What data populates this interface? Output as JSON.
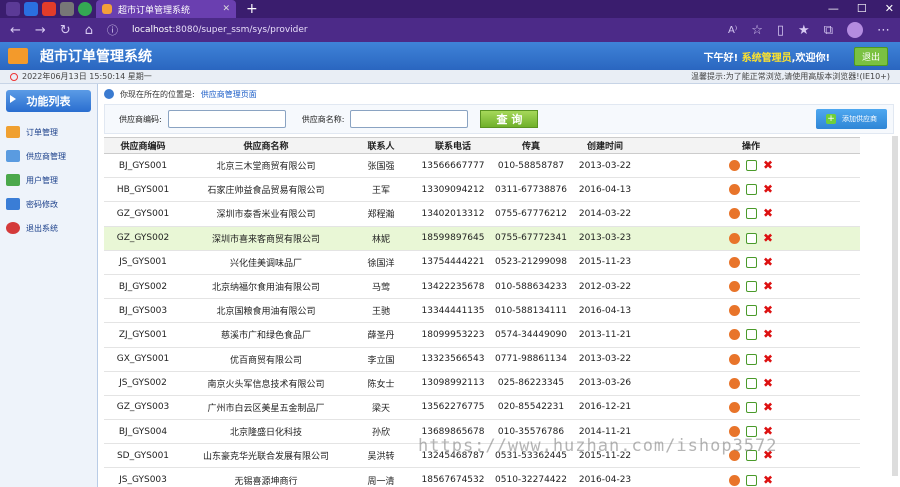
{
  "browser": {
    "tab_title": "超市订单管理系统",
    "url_host": "localhost",
    "url_path": ":8080/super_ssm/sys/provider"
  },
  "header": {
    "app_title": "超市订单管理系统",
    "greet_prefix": "下午好!",
    "user": "系统管理员",
    "greet_suffix": ",欢迎你!",
    "exit_label": "退出"
  },
  "infobar": {
    "datetime": "2022年06月13日 15:50:14 星期一",
    "tip": "温馨提示:为了能正常浏览,请使用高版本浏览器!(IE10+)"
  },
  "sidebar": {
    "heading": "功能列表",
    "items": [
      {
        "label": "订单管理",
        "color": "#f0a030"
      },
      {
        "label": "供应商管理",
        "color": "#5a9be0"
      },
      {
        "label": "用户管理",
        "color": "#4ba84b"
      },
      {
        "label": "密码修改",
        "color": "#3a7dd6"
      },
      {
        "label": "退出系统",
        "color": "#d43a3a"
      }
    ]
  },
  "crumb": {
    "prefix": "你现在所在的位置是:",
    "current": "供应商管理页面"
  },
  "search": {
    "code_label": "供应商编码:",
    "name_label": "供应商名称:",
    "code_value": "",
    "name_value": "",
    "query_label": "查 询",
    "add_label": "添加供应商"
  },
  "table": {
    "headers": [
      "供应商编码",
      "供应商名称",
      "联系人",
      "联系电话",
      "传真",
      "创建时间",
      "操作"
    ],
    "rows": [
      [
        "BJ_GYS001",
        "北京三木堂商贸有限公司",
        "张国强",
        "13566667777",
        "010-58858787",
        "2013-03-22"
      ],
      [
        "HB_GYS001",
        "石家庄帅益食品贸易有限公司",
        "王军",
        "13309094212",
        "0311-67738876",
        "2016-04-13"
      ],
      [
        "GZ_GYS001",
        "深圳市泰香米业有限公司",
        "郑程瀚",
        "13402013312",
        "0755-67776212",
        "2014-03-22"
      ],
      [
        "GZ_GYS002",
        "深圳市喜来客商贸有限公司",
        "林妮",
        "18599897645",
        "0755-67772341",
        "2013-03-23"
      ],
      [
        "JS_GYS001",
        "兴化佳美调味品厂",
        "徐国洋",
        "13754444221",
        "0523-21299098",
        "2015-11-23"
      ],
      [
        "BJ_GYS002",
        "北京纳福尔食用油有限公司",
        "马莺",
        "13422235678",
        "010-588634233",
        "2012-03-22"
      ],
      [
        "BJ_GYS003",
        "北京国粮食用油有限公司",
        "王驰",
        "13344441135",
        "010-588134111",
        "2016-04-13"
      ],
      [
        "ZJ_GYS001",
        "慈溪市广和绿色食品厂",
        "薛圣丹",
        "18099953223",
        "0574-34449090",
        "2013-11-21"
      ],
      [
        "GX_GYS001",
        "优百商贸有限公司",
        "李立国",
        "13323566543",
        "0771-98861134",
        "2013-03-22"
      ],
      [
        "JS_GYS002",
        "南京火头军信息技术有限公司",
        "陈女士",
        "13098992113",
        "025-86223345",
        "2013-03-26"
      ],
      [
        "GZ_GYS003",
        "广州市白云区美星五金制品厂",
        "梁天",
        "13562276775",
        "020-85542231",
        "2016-12-21"
      ],
      [
        "BJ_GYS004",
        "北京隆盛日化科技",
        "孙欣",
        "13689865678",
        "010-35576786",
        "2014-11-21"
      ],
      [
        "SD_GYS001",
        "山东豪克华光联合发展有限公司",
        "吴洪转",
        "13245468787",
        "0531-53362445",
        "2015-11-22"
      ],
      [
        "JS_GYS003",
        "无锡喜源坤商行",
        "周一清",
        "18567674532",
        "0510-32274422",
        "2016-04-23"
      ]
    ],
    "highlight_row": 3
  },
  "watermark": "https://www.huzhan.com/ishop3572"
}
